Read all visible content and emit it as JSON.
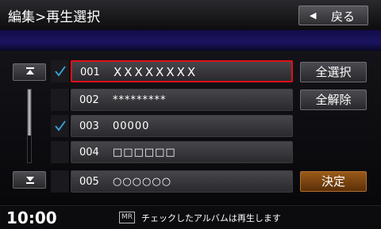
{
  "header": {
    "title": "編集>再生選択",
    "back_label": "戻る",
    "back_icon": "triangle-left-icon"
  },
  "list": {
    "rows": [
      {
        "num": "001",
        "name": "XXXXXXXX",
        "checked": true,
        "selected": true
      },
      {
        "num": "002",
        "name": "*********",
        "checked": false,
        "selected": false
      },
      {
        "num": "003",
        "name": "00000",
        "checked": true,
        "selected": false
      },
      {
        "num": "004",
        "name": "□□□□□□",
        "checked": false,
        "selected": false
      },
      {
        "num": "005",
        "name": "○○○○○○",
        "checked": false,
        "selected": false
      }
    ]
  },
  "side": {
    "select_all": "全選択",
    "deselect_all": "全解除",
    "confirm": "決定"
  },
  "status": {
    "time": "10:00",
    "mr_badge": "MR",
    "message": "チェックしたアルバムは再生します"
  },
  "colors": {
    "selection_border": "#e0101a",
    "checkmark": "#3aa8e0",
    "confirm_button": "#9a5a18"
  }
}
